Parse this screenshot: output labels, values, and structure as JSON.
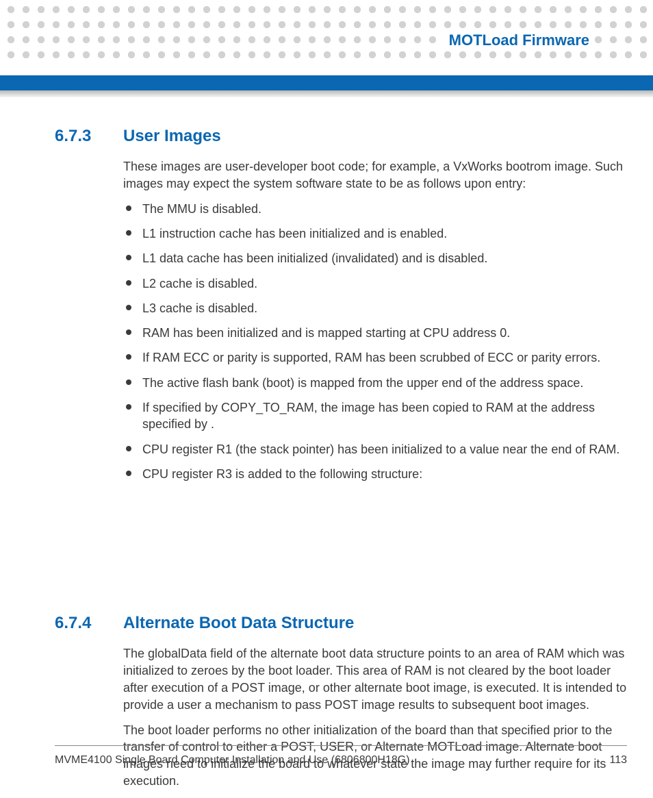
{
  "header": {
    "title": "MOTLoad Firmware"
  },
  "sections": [
    {
      "number": "6.7.3",
      "title": "User Images",
      "intro": "These images are user-developer boot code; for example, a VxWorks bootrom image. Such images may expect the system software state to be as follows upon entry:",
      "bullets": [
        "The MMU is disabled.",
        "L1 instruction cache has been initialized and is enabled.",
        "L1 data cache has been initialized (invalidated) and is disabled.",
        "L2 cache is disabled.",
        "L3 cache is disabled.",
        "RAM has been initialized and is mapped starting at CPU address 0.",
        "If RAM ECC or parity is supported, RAM has been scrubbed of ECC or parity errors.",
        "The active flash bank (boot) is mapped from the upper end of the address space.",
        "If specified by COPY_TO_RAM, the image has been copied to RAM at the address specified by                                        .",
        "CPU register R1 (the stack pointer) has been initialized to a value near the end of RAM.",
        "CPU register R3 is added to the following structure:"
      ]
    },
    {
      "number": "6.7.4",
      "title": "Alternate Boot Data Structure",
      "paragraphs": [
        "The globalData field of the alternate boot data structure points to an area of RAM which was initialized to zeroes by the boot loader. This area of RAM is not cleared by the boot loader after execution of a POST image, or other alternate boot image, is executed. It is intended to provide a user a mechanism to pass POST image results to subsequent boot images.",
        "The boot loader performs no other initialization of the board than that specified prior to the transfer of control to either a POST, USER, or Alternate MOTLoad image. Alternate boot images need to initialize the board to whatever state the image may further require for its execution."
      ]
    }
  ],
  "footer": {
    "doc": "MVME4100 Single Board Computer Installation and Use (6806800H18G)",
    "page": "113"
  }
}
